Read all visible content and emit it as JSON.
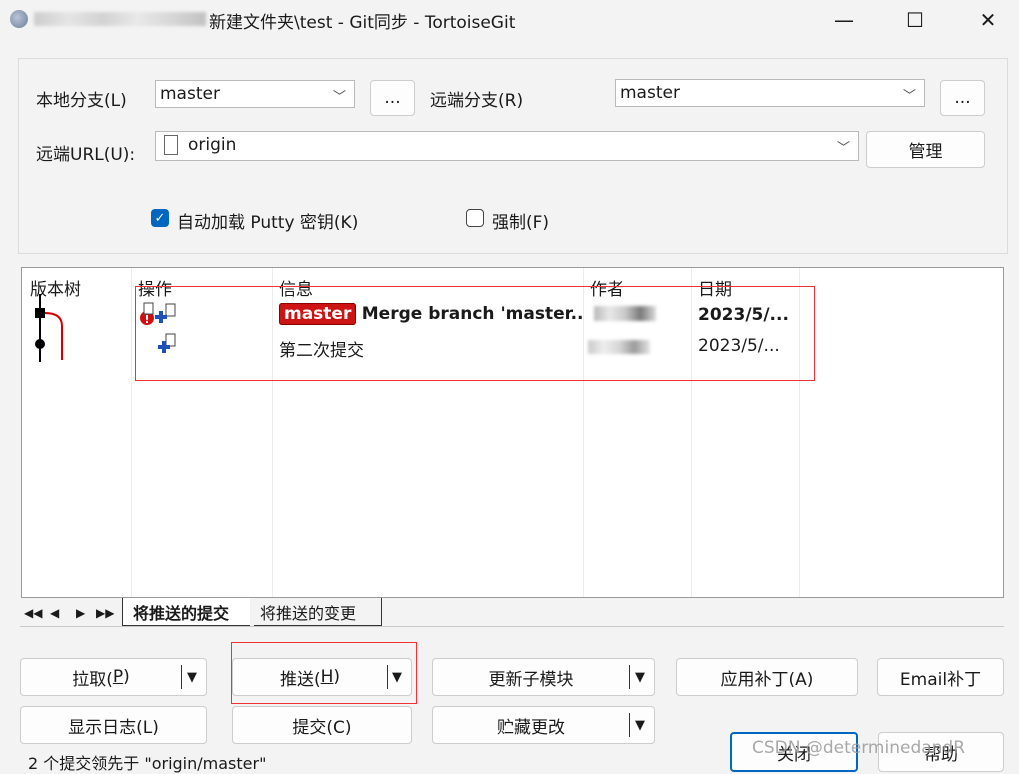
{
  "window": {
    "title": "新建文件夹\\test - Git同步 - TortoiseGit",
    "minimize": "—",
    "maximize": "☐",
    "close": "✕"
  },
  "form": {
    "local_branch_label": "本地分支(L)",
    "local_branch_value": "master",
    "browse_label": "...",
    "remote_branch_label": "远端分支(R)",
    "remote_branch_value": "master",
    "remote_url_label": "远端URL(U):",
    "remote_url_value": "origin",
    "manage_label": "管理",
    "autoload_putty_label": "自动加载 Putty 密钥(K)",
    "autoload_putty_checked": true,
    "force_label": "强制(F)",
    "force_checked": false
  },
  "list": {
    "columns": [
      "版本树",
      "操作",
      "信息",
      "作者",
      "日期"
    ],
    "rows": [
      {
        "badge": "master",
        "message": "Merge branch 'master..",
        "date": "2023/5/...",
        "bold": true
      },
      {
        "badge": "",
        "message": "第二次提交",
        "date": "2023/5/...",
        "bold": false
      }
    ]
  },
  "tabs": {
    "nav": [
      "◀◀",
      "◀",
      "▶",
      "▶▶"
    ],
    "items": [
      "将推送的提交",
      "将推送的变更"
    ],
    "active": 0
  },
  "buttons": {
    "pull": {
      "text": "拉取(",
      "key": "P",
      "end": ")"
    },
    "push": {
      "text": "推送(",
      "key": "H",
      "end": ")"
    },
    "update_submodules": "更新子模块",
    "apply_patch": "应用补丁(A)",
    "email_patch": "Email补丁",
    "show_log": "显示日志(L)",
    "commit": "提交(C)",
    "stash": "贮藏更改",
    "close": "关闭",
    "help": "帮助"
  },
  "status": "2 个提交领先于 \"origin/master\"",
  "watermark": "CSDN @determinedandR",
  "colors": {
    "accent": "#0067c0",
    "branch_badge": "#cc1414",
    "highlight_box": "#ee3333"
  }
}
